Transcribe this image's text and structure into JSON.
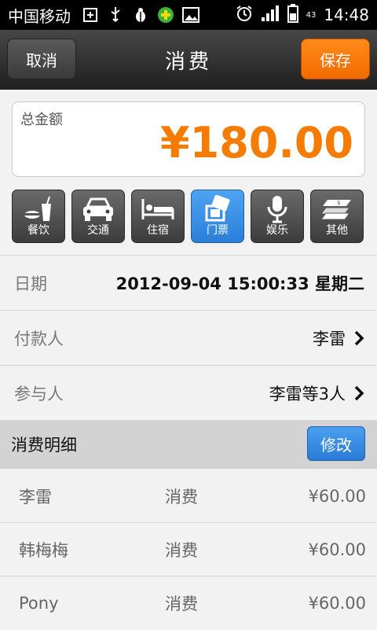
{
  "status_bar": {
    "carrier": "中国移动",
    "icons": [
      "add-box-icon",
      "usb-icon",
      "bug-icon",
      "app-plus-icon",
      "image-icon"
    ],
    "right_icons": [
      "alarm-icon",
      "signal-icon",
      "battery-icon"
    ],
    "battery_percent": "43",
    "time": "14:48"
  },
  "header": {
    "cancel_label": "取消",
    "title": "消费",
    "save_label": "保存"
  },
  "amount": {
    "label": "总金额",
    "value": "¥180.00",
    "accent_color": "#f57c00"
  },
  "categories": [
    {
      "label": "餐饮",
      "icon": "food-drink-icon",
      "active": false
    },
    {
      "label": "交通",
      "icon": "car-icon",
      "active": false
    },
    {
      "label": "住宿",
      "icon": "bed-icon",
      "active": false
    },
    {
      "label": "门票",
      "icon": "ticket-icon",
      "active": true
    },
    {
      "label": "娱乐",
      "icon": "microphone-icon",
      "active": false
    },
    {
      "label": "其他",
      "icon": "money-icon",
      "active": false
    }
  ],
  "info": {
    "date_label": "日期",
    "date_value": "2012-09-04 15:00:33 星期二",
    "payer_label": "付款人",
    "payer_value": "李雷",
    "participants_label": "参与人",
    "participants_value": "李雷等3人"
  },
  "details": {
    "title": "消费明细",
    "edit_label": "修改",
    "rows": [
      {
        "name": "李雷",
        "type": "消费",
        "amount": "¥60.00"
      },
      {
        "name": "韩梅梅",
        "type": "消费",
        "amount": "¥60.00"
      },
      {
        "name": "Pony",
        "type": "消费",
        "amount": "¥60.00"
      }
    ]
  }
}
